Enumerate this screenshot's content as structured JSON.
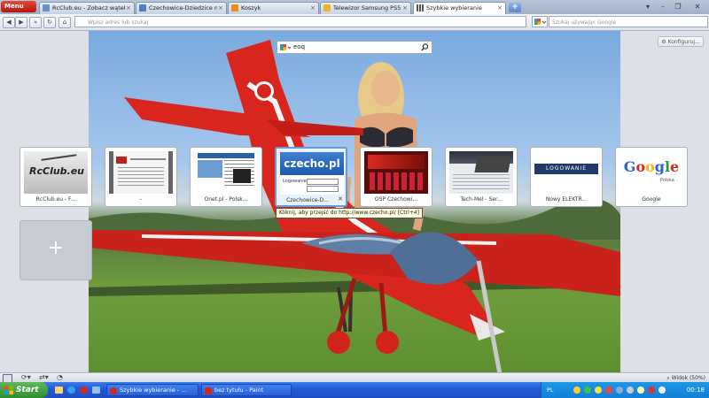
{
  "browser": {
    "menu_label": "Menu",
    "tabs": [
      {
        "label": "RcClub.eu - Zobacz wątek",
        "active": false,
        "icon_color": "#6b8fc9"
      },
      {
        "label": "Czechowice-Dziedzice m...",
        "active": false,
        "icon_color": "#4a7fc1"
      },
      {
        "label": "Koszyk",
        "active": false,
        "icon_color": "#f08a1d"
      },
      {
        "label": "Telewizor Samsung PS51...",
        "active": false,
        "icon_color": "#f0b41d"
      },
      {
        "label": "Szybkie wybieranie",
        "active": true,
        "icon_color": "#555555"
      }
    ],
    "address_placeholder": "Wpisz adres lub szukaj",
    "search_placeholder": "Szukaj używając Google"
  },
  "speed_dial": {
    "search_query": "eoq",
    "configure_label": "Konfiguruj...",
    "tiles": [
      {
        "label": "RcClub.eu - F...",
        "thumb": "rcclub"
      },
      {
        "label": "-",
        "thumb": "doc"
      },
      {
        "label": "Onet.pl - Polsk...",
        "thumb": "onet"
      },
      {
        "label": "Czechowice-D...",
        "thumb": "czecho",
        "selected": true
      },
      {
        "label": "OSP Czechowi...",
        "thumb": "osp"
      },
      {
        "label": "Tech-Mel - Ser...",
        "thumb": "techmel"
      },
      {
        "label": "Nowy ELEKTR...",
        "thumb": "elektr"
      },
      {
        "label": "Google",
        "thumb": "google"
      }
    ],
    "add_label": "+",
    "tooltip": "Kliknij, aby przejść do http://www.czecho.pl/ [Ctrl+4]",
    "thumb_text": {
      "rcclub": "RcClub.eu",
      "czecho": "czecho.pl",
      "czecho_login": "Logowanie",
      "elektr": "LOGOWANIE",
      "google": "Google",
      "google_sub": "Polska"
    }
  },
  "statusbar": {
    "zoom": "Widok (50%)"
  },
  "taskbar": {
    "start_label": "Start",
    "tasks": [
      {
        "label": "Szybkie wybieranie - ...",
        "icon_color": "#d2281c"
      },
      {
        "label": "bez tytułu - Paint",
        "icon_color": "#d2281c"
      }
    ],
    "lang": "PL",
    "clock": "00:18"
  }
}
